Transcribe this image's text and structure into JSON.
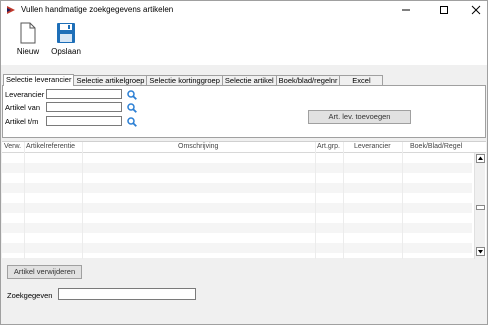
{
  "window": {
    "title": "Vullen handmatige zoekgegevens artikelen"
  },
  "toolbar": {
    "new_label": "Nieuw",
    "save_label": "Opslaan"
  },
  "tabs": [
    {
      "label": "Selectie leverancier",
      "active": true
    },
    {
      "label": "Selectie artikelgroep",
      "active": false
    },
    {
      "label": "Selectie kortinggroep",
      "active": false
    },
    {
      "label": "Selectie artikel",
      "active": false
    },
    {
      "label": "Boek/blad/regelnr",
      "active": false
    },
    {
      "label": "Excel",
      "active": false
    }
  ],
  "filters": {
    "leverancier_label": "Leverancier",
    "leverancier_value": "",
    "artikel_van_label": "Artikel van",
    "artikel_van_value": "",
    "artikel_tm_label": "Artikel t/m",
    "artikel_tm_value": "",
    "add_button": "Art. lev. toevoegen"
  },
  "grid": {
    "columns": [
      "Verw.",
      "Artikelreferentie",
      "Omschrijving",
      "Art.grp.",
      "Leverancier",
      "Boek/Blad/Regel"
    ],
    "rows": []
  },
  "bottom": {
    "remove_button": "Artikel verwijderen",
    "zoek_label": "Zoekgegeven",
    "zoek_value": ""
  },
  "colors": {
    "window_bg": "#f0f0f0",
    "panel_bg": "#ffffff",
    "save_icon": "#1e6fb8",
    "search_icon": "#2b7fd4"
  }
}
